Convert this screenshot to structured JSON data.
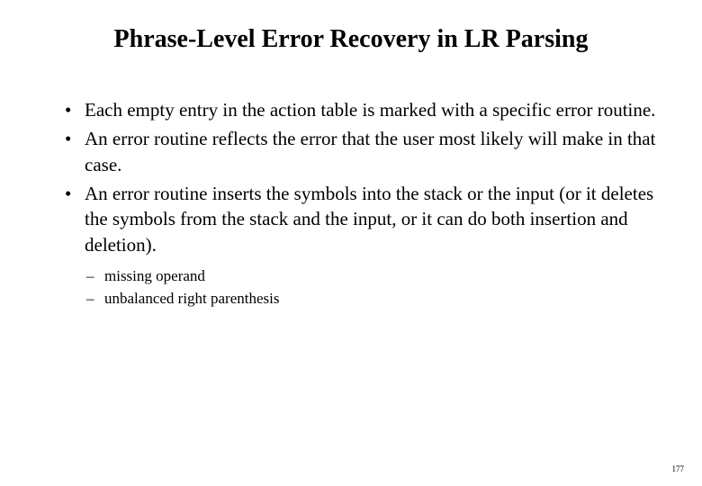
{
  "slide": {
    "title": "Phrase-Level Error Recovery in LR Parsing",
    "bullets": [
      "Each empty entry in the action table is marked with a specific error routine.",
      "An error routine  reflects the error that the user most likely will make in that case.",
      "An error routine inserts the symbols into the stack or the input (or it deletes the symbols from the stack and the input, or it can do both insertion and deletion)."
    ],
    "sub_bullets": [
      "missing operand",
      "unbalanced right parenthesis"
    ],
    "page_number": "177"
  }
}
